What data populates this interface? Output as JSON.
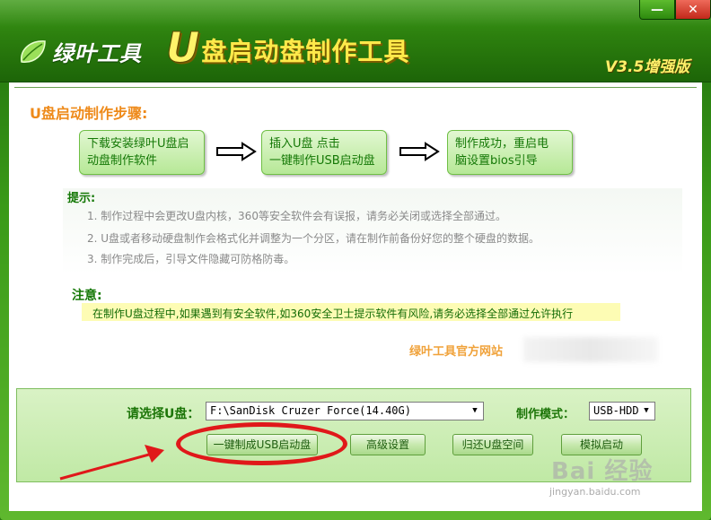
{
  "window": {
    "logo_text": "绿叶工具",
    "title_u": "U",
    "title_rest": "盘启动盘制作工具",
    "version": "V3.5增强版",
    "minimize_glyph": "—",
    "close_glyph": "✕"
  },
  "steps": {
    "title": "U盘启动制作步骤:",
    "items": [
      {
        "line1": "下载安装绿叶U盘启",
        "line2": "动盘制作软件"
      },
      {
        "line1": "插入U盘 点击",
        "line2": "一键制作USB启动盘"
      },
      {
        "line1": "制作成功，重启电",
        "line2": "脑设置bios引导"
      }
    ]
  },
  "tips": {
    "title": "提示:",
    "items": [
      "1. 制作过程中会更改U盘内核，360等安全软件会有误报，请务必关闭或选择全部通过。",
      "2. U盘或者移动硬盘制作会格式化并调整为一个分区，请在制作前备份好您的整个硬盘的数据。",
      "3. 制作完成后，引导文件隐藏可防格防毒。"
    ]
  },
  "notice": {
    "title": "注意:",
    "text": "在制作U盘过程中,如果遇到有安全软件,如360安全卫士提示软件有风险,请务必选择全部通过允许执行"
  },
  "site_link": "绿叶工具官方网站",
  "controls": {
    "usb_label": "请选择U盘：",
    "usb_value": "F:\\SanDisk Cruzer Force(14.40G)",
    "mode_label": "制作模式：",
    "mode_value": "USB-HDD",
    "dropdown_glyph": "▼",
    "buttons": {
      "make": "一键制成USB启动盘",
      "advanced": "高级设置",
      "restore": "归还U盘空间",
      "simulate": "模拟启动"
    }
  },
  "watermark": {
    "brand": "Bai 经验",
    "url": "jingyan.baidu.com"
  },
  "colors": {
    "brand_green": "#2c7f0e",
    "title_yellow": "#ffe94a",
    "step_title_orange": "#ee8a1a",
    "highlight_red": "#e0181a"
  }
}
